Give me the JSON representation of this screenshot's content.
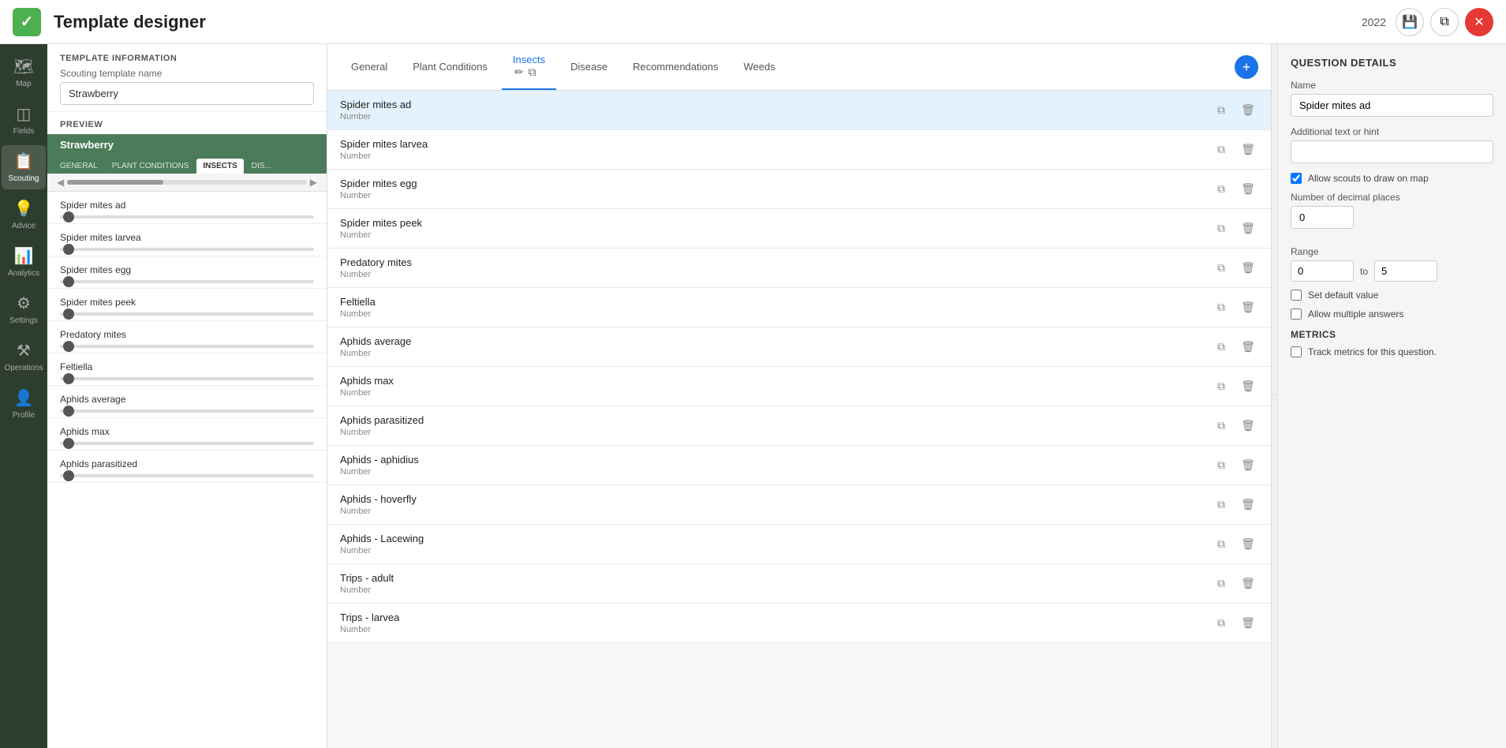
{
  "header": {
    "logo": "✓",
    "title": "Template designer",
    "year": "2022",
    "icons": [
      "○",
      "⧉",
      "✕"
    ]
  },
  "sidebar": {
    "items": [
      {
        "id": "map",
        "label": "Map",
        "icon": "🗺",
        "active": false
      },
      {
        "id": "fields",
        "label": "Fields",
        "icon": "◫",
        "active": false
      },
      {
        "id": "scouting",
        "label": "Scouting",
        "icon": "📋",
        "active": true
      },
      {
        "id": "advice",
        "label": "Advice",
        "icon": "💡",
        "active": false
      },
      {
        "id": "analytics",
        "label": "Analytics",
        "icon": "📊",
        "active": false
      },
      {
        "id": "settings",
        "label": "Settings",
        "icon": "⚙",
        "active": false
      },
      {
        "id": "operations",
        "label": "Operations",
        "icon": "⚒",
        "active": false
      },
      {
        "id": "profile",
        "label": "Profile",
        "icon": "👤",
        "active": false
      }
    ]
  },
  "left_panel": {
    "template_info_title": "TEMPLATE INFORMATION",
    "scouting_label": "Scouting template name",
    "template_name": "Strawberry",
    "preview_label": "PREVIEW",
    "crop_name": "Strawberry",
    "tabs": [
      {
        "label": "GENERAL",
        "active": false
      },
      {
        "label": "PLANT CONDITIONS",
        "active": false
      },
      {
        "label": "INSECTS",
        "active": true
      },
      {
        "label": "DIS...",
        "active": false
      }
    ],
    "preview_items": [
      {
        "label": "Spider mites ad"
      },
      {
        "label": "Spider mites larvea"
      },
      {
        "label": "Spider mites egg"
      },
      {
        "label": "Spider mites peek"
      },
      {
        "label": "Predatory mites"
      },
      {
        "label": "Feltiella"
      },
      {
        "label": "Aphids average"
      },
      {
        "label": "Aphids max"
      },
      {
        "label": "Aphids parasitized"
      }
    ]
  },
  "center_panel": {
    "tabs": [
      {
        "label": "General",
        "active": false
      },
      {
        "label": "Plant Conditions",
        "active": false
      },
      {
        "label": "Insects",
        "active": true
      },
      {
        "label": "Disease",
        "active": false
      },
      {
        "label": "Recommendations",
        "active": false
      },
      {
        "label": "Weeds",
        "active": false
      }
    ],
    "add_btn_label": "+",
    "questions": [
      {
        "name": "Spider mites ad",
        "type": "Number",
        "selected": true
      },
      {
        "name": "Spider mites larvea",
        "type": "Number",
        "selected": false
      },
      {
        "name": "Spider mites egg",
        "type": "Number",
        "selected": false
      },
      {
        "name": "Spider mites peek",
        "type": "Number",
        "selected": false
      },
      {
        "name": "Predatory mites",
        "type": "Number",
        "selected": false
      },
      {
        "name": "Feltiella",
        "type": "Number",
        "selected": false
      },
      {
        "name": "Aphids average",
        "type": "Number",
        "selected": false
      },
      {
        "name": "Aphids max",
        "type": "Number",
        "selected": false
      },
      {
        "name": "Aphids parasitized",
        "type": "Number",
        "selected": false
      },
      {
        "name": "Aphids - aphidius",
        "type": "Number",
        "selected": false
      },
      {
        "name": "Aphids - hoverfly",
        "type": "Number",
        "selected": false
      },
      {
        "name": "Aphids - Lacewing",
        "type": "Number",
        "selected": false
      },
      {
        "name": "Trips - adult",
        "type": "Number",
        "selected": false
      },
      {
        "name": "Trips - larvea",
        "type": "Number",
        "selected": false
      }
    ]
  },
  "right_panel": {
    "title": "QUESTION DETAILS",
    "name_label": "Name",
    "name_value": "Spider mites ad",
    "hint_label": "Additional text or hint",
    "hint_value": "",
    "allow_draw_label": "Allow scouts to draw on map",
    "allow_draw_checked": true,
    "decimal_label": "Number of decimal places",
    "decimal_value": "0",
    "range_label": "Range",
    "range_from": "0",
    "range_to": "5",
    "set_default_label": "Set default value",
    "set_default_checked": false,
    "allow_multiple_label": "Allow multiple answers",
    "allow_multiple_checked": false,
    "metrics_title": "METRICS",
    "track_metrics_label": "Track metrics for this question.",
    "track_metrics_checked": false
  }
}
